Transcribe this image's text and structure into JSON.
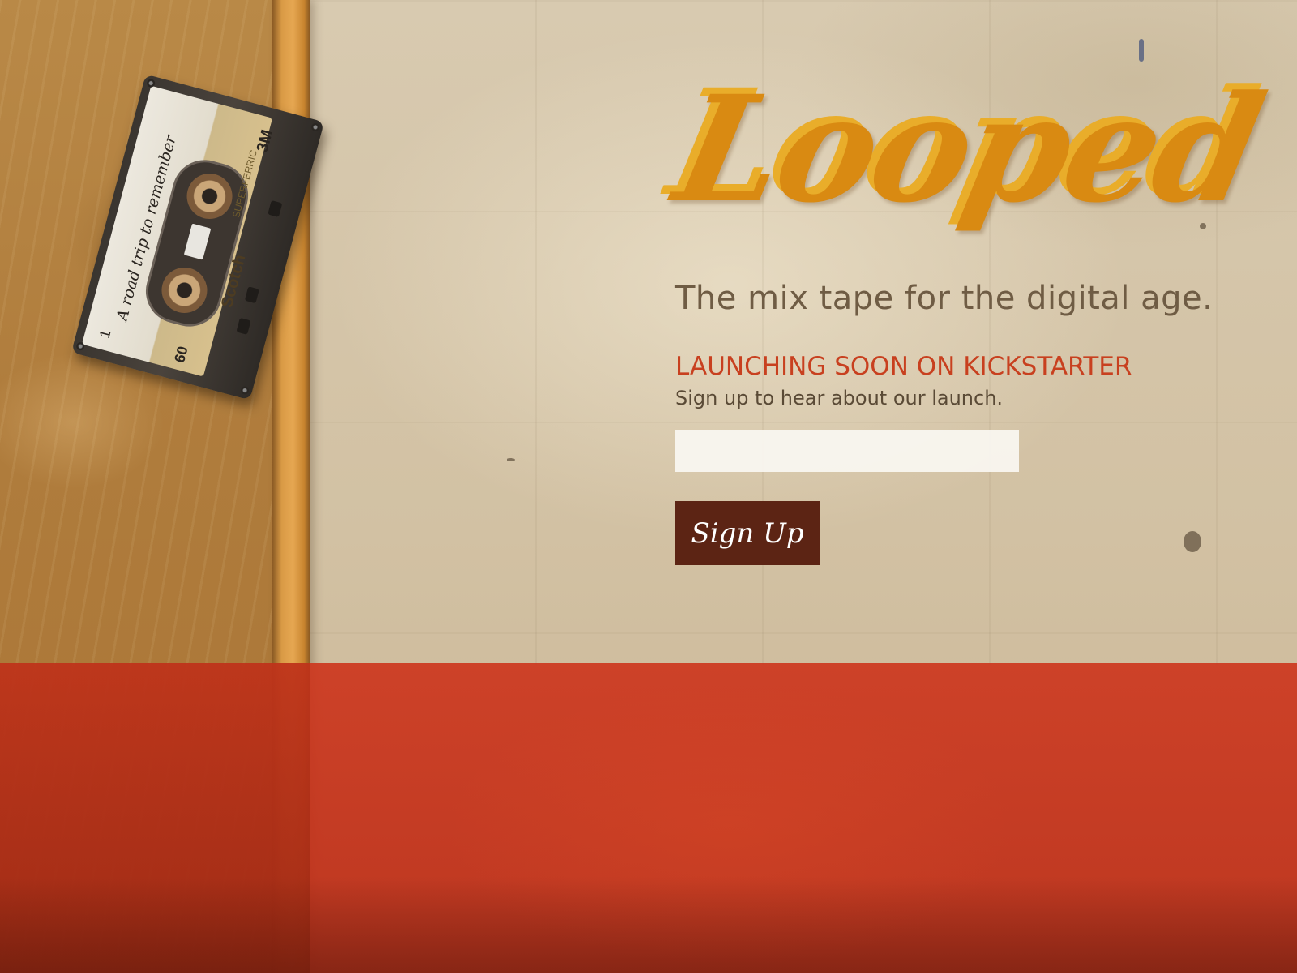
{
  "brand": {
    "logo_text": "Looped"
  },
  "hero": {
    "tagline": "The mix tape for the digital age.",
    "launch_heading": "LAUNCHING SOON ON KICKSTARTER",
    "signup_prompt": "Sign up to hear about our launch."
  },
  "form": {
    "email_value": "",
    "email_placeholder": "",
    "submit_label": "Sign Up"
  },
  "cassette": {
    "handwritten_label": "A road trip to remember",
    "brand": "Scotch",
    "maker": "3M",
    "tape_type": "SUPERFERRIC",
    "side": "1",
    "length": "60"
  },
  "colors": {
    "logo": "#d98a12",
    "logo_shadow": "#e9ad2a",
    "launch_heading": "#c8401f",
    "button": "#5c2414",
    "band": "#c1321b"
  }
}
